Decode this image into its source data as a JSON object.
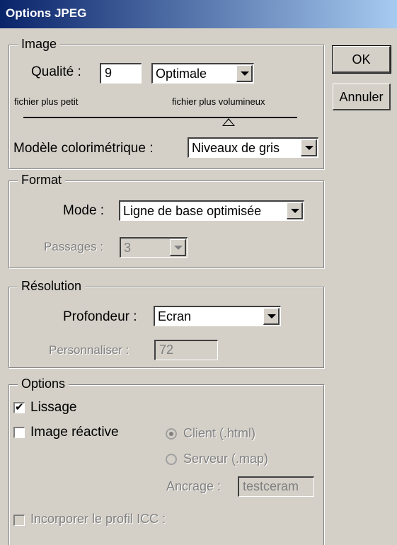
{
  "window": {
    "title": "Options JPEG"
  },
  "buttons": {
    "ok": "OK",
    "cancel": "Annuler"
  },
  "image_group": {
    "legend": "Image",
    "quality_label": "Qualité :",
    "quality_value": "9",
    "quality_preset": "Optimale",
    "small_file_label": "fichier plus petit",
    "large_file_label": "fichier plus volumineux",
    "quality_level": 0.75,
    "color_model_label": "Modèle colorimétrique :",
    "color_model_value": "Niveaux de gris"
  },
  "format_group": {
    "legend": "Format",
    "mode_label": "Mode :",
    "mode_value": "Ligne de base optimisée",
    "passes_label": "Passages :",
    "passes_value": "3"
  },
  "resolution_group": {
    "legend": "Résolution",
    "depth_label": "Profondeur :",
    "depth_value": "Ecran",
    "custom_label": "Personnaliser :",
    "custom_value": "72"
  },
  "options_group": {
    "legend": "Options",
    "smoothing_label": "Lissage",
    "smoothing_checked": true,
    "imagemap_label": "Image réactive",
    "imagemap_checked": false,
    "client_label": "Client (.html)",
    "server_label": "Serveur (.map)",
    "anchor_label": "Ancrage :",
    "anchor_value": "testceram",
    "icc_label": "Incorporer le profil ICC :"
  }
}
